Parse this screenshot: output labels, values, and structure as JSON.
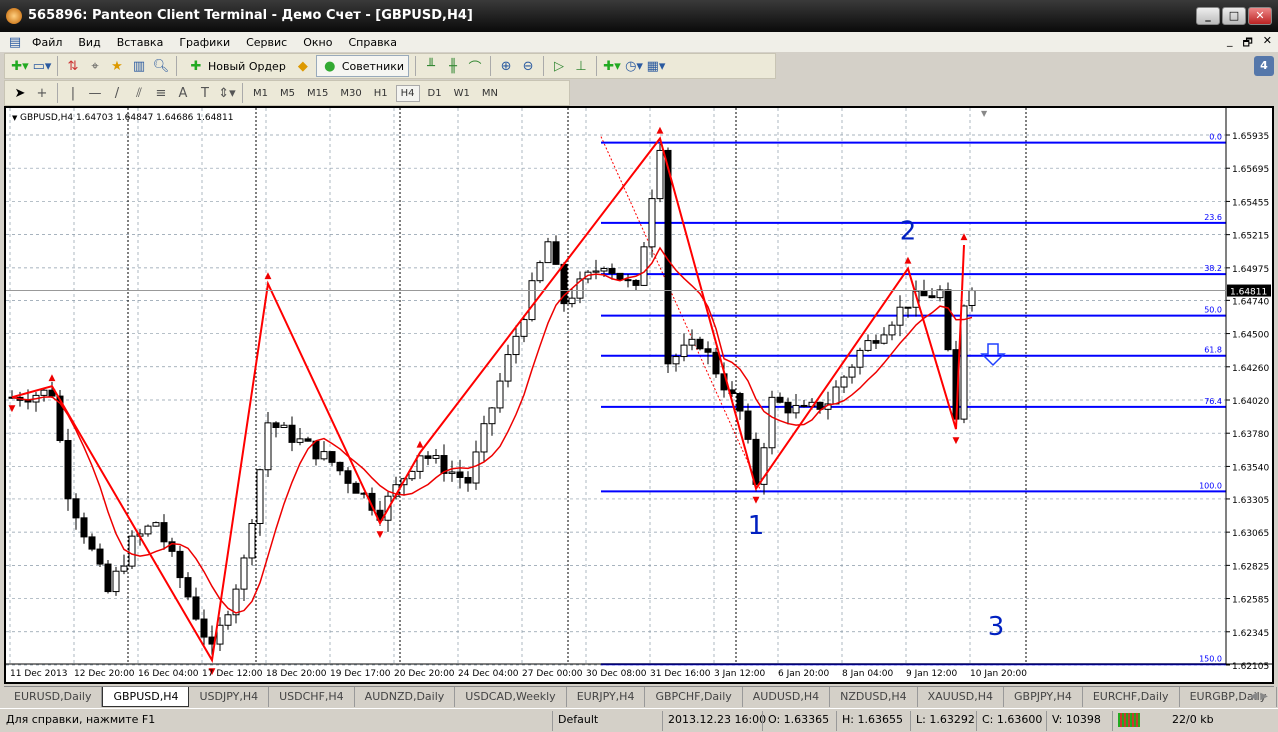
{
  "window": {
    "title": "565896: Panteon Client Terminal - Демо Счет - [GBPUSD,H4]",
    "minimize": "_",
    "maximize": "□",
    "close": "✕"
  },
  "menu": [
    "Файл",
    "Вид",
    "Вставка",
    "Графики",
    "Сервис",
    "Окно",
    "Справка"
  ],
  "mdi_buttons": [
    "_",
    "🗗",
    "✕"
  ],
  "toolbar": {
    "new_order": "Новый Ордер",
    "experts": "Советники",
    "timeframes": [
      "M1",
      "M5",
      "M15",
      "M30",
      "H1",
      "H4",
      "D1",
      "W1",
      "MN"
    ],
    "active_timeframe": "H4"
  },
  "chart": {
    "header": "GBPUSD,H4  1.64703 1.64847 1.64686 1.64811",
    "current_price": "1.64811",
    "price_labels": [
      "1.65935",
      "1.65695",
      "1.65455",
      "1.65215",
      "1.64975",
      "1.64740",
      "1.64500",
      "1.64260",
      "1.64020",
      "1.63780",
      "1.63540",
      "1.63305",
      "1.63065",
      "1.62825",
      "1.62585",
      "1.62345",
      "1.62105"
    ],
    "time_labels": [
      "11 Dec 2013",
      "12 Dec 20:00",
      "16 Dec 04:00",
      "17 Dec 12:00",
      "18 Dec 20:00",
      "19 Dec 17:00",
      "20 Dec 20:00",
      "24 Dec 04:00",
      "27 Dec 00:00",
      "30 Dec 08:00",
      "31 Dec 16:00",
      "3 Jan 12:00",
      "6 Jan 20:00",
      "8 Jan 04:00",
      "9 Jan 12:00",
      "10 Jan 20:00"
    ],
    "fib_levels": [
      {
        "label": "0.0",
        "price": 1.6588
      },
      {
        "label": "23.6",
        "price": 1.653
      },
      {
        "label": "38.2",
        "price": 1.6493
      },
      {
        "label": "50.0",
        "price": 1.6463
      },
      {
        "label": "61.8",
        "price": 1.6434
      },
      {
        "label": "76.4",
        "price": 1.6397
      },
      {
        "label": "100.0",
        "price": 1.6336
      },
      {
        "label": "150.0",
        "price": 1.6211
      }
    ],
    "wave_labels": [
      {
        "text": "1",
        "price": 1.6305,
        "bar": 93
      },
      {
        "text": "2",
        "price": 1.6518,
        "bar": 112
      },
      {
        "text": "3",
        "price": 1.6232,
        "bar": 123
      }
    ],
    "colors": {
      "fib": "#0000ff",
      "zigzag": "#ff0000",
      "bull": "#ffffff",
      "bear": "#000000"
    },
    "price_path": [
      [
        0,
        1.6404
      ],
      [
        5,
        1.6408
      ],
      [
        7,
        1.6336
      ],
      [
        12,
        1.6263
      ],
      [
        15,
        1.6299
      ],
      [
        18,
        1.6314
      ],
      [
        25,
        1.622
      ],
      [
        29,
        1.6285
      ],
      [
        32,
        1.6386
      ],
      [
        36,
        1.6372
      ],
      [
        40,
        1.6357
      ],
      [
        46,
        1.6321
      ],
      [
        51,
        1.6364
      ],
      [
        57,
        1.6343
      ],
      [
        61,
        1.6415
      ],
      [
        67,
        1.6516
      ],
      [
        69,
        1.6473
      ],
      [
        74,
        1.6502
      ],
      [
        78,
        1.648
      ],
      [
        81,
        1.6588
      ],
      [
        82,
        1.643
      ],
      [
        86,
        1.6444
      ],
      [
        91,
        1.6393
      ],
      [
        93,
        1.6343
      ],
      [
        95,
        1.6401
      ],
      [
        99,
        1.6393
      ],
      [
        102,
        1.6401
      ],
      [
        106,
        1.6437
      ],
      [
        112,
        1.6473
      ],
      [
        116,
        1.648
      ],
      [
        118,
        1.6386
      ],
      [
        119,
        1.6473
      ],
      [
        120,
        1.6481
      ]
    ],
    "zigzag": [
      [
        0,
        1.6404
      ],
      [
        5,
        1.6412
      ],
      [
        25,
        1.6214
      ],
      [
        32,
        1.6486
      ],
      [
        46,
        1.6313
      ],
      [
        51,
        1.6364
      ],
      [
        81,
        1.6591
      ],
      [
        93,
        1.6338
      ],
      [
        112,
        1.6497
      ],
      [
        118,
        1.6381
      ],
      [
        119,
        1.6514
      ]
    ]
  },
  "tabs": [
    "EURUSD,Daily",
    "GBPUSD,H4",
    "USDJPY,H4",
    "USDCHF,H4",
    "AUDNZD,Daily",
    "USDCAD,Weekly",
    "EURJPY,H4",
    "GBPCHF,Daily",
    "AUDUSD,H4",
    "NZDUSD,H4",
    "XAUUSD,H4",
    "GBPJPY,H4",
    "EURCHF,Daily",
    "EURGBP,Daily"
  ],
  "active_tab": "GBPUSD,H4",
  "status": {
    "help": "Для справки, нажмите F1",
    "profile": "Default",
    "datetime": "2013.12.23 16:00",
    "open": "O: 1.63365",
    "high": "H: 1.63655",
    "low": "L: 1.63292",
    "close": "C: 1.63600",
    "volume": "V: 10398",
    "traffic": "22/0 kb"
  }
}
